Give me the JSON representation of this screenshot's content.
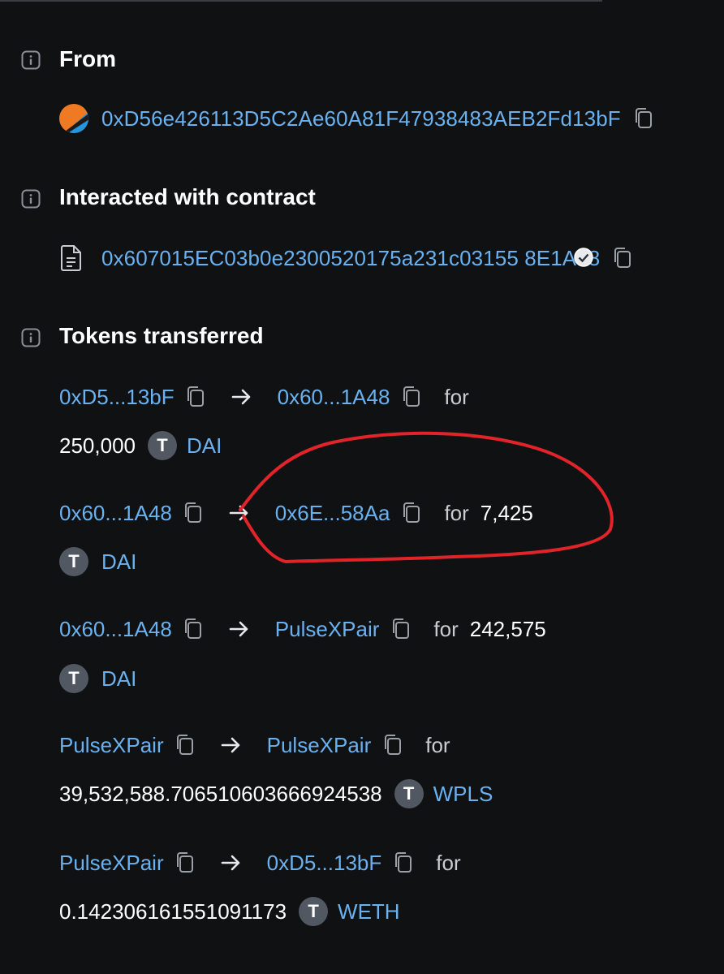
{
  "from": {
    "title": "From",
    "address": "0xD56e426113D5C2Ae60A81F47938483AEB2Fd13bF"
  },
  "contract": {
    "title": "Interacted with contract",
    "address": "0x607015EC03b0e2300520175a231c03155  8E1A48"
  },
  "tokens": {
    "title": "Tokens transferred",
    "transfers": [
      {
        "from": "0xD5...13bF",
        "to": "0x60...1A48",
        "for": "for",
        "amount": "250,000",
        "badge": "T",
        "token": "DAI"
      },
      {
        "from": "0x60...1A48",
        "to": "0x6E...58Aa",
        "for": "for",
        "amount": "7,425",
        "badge": "T",
        "token": "DAI"
      },
      {
        "from": "0x60...1A48",
        "to": "PulseXPair",
        "for": "for",
        "amount": "242,575",
        "badge": "T",
        "token": "DAI"
      },
      {
        "from": "PulseXPair",
        "to": "PulseXPair",
        "for": "for",
        "amount": "39,532,588.706510603666924538",
        "badge": "T",
        "token": "WPLS"
      },
      {
        "from": "PulseXPair",
        "to": "0xD5...13bF",
        "for": "for",
        "amount": "0.142306161551091173",
        "badge": "T",
        "token": "WETH"
      }
    ]
  },
  "colors": {
    "background": "#101113",
    "link": "#6ab1f0",
    "text": "#ffffff",
    "muted": "#c9ccd1",
    "badge": "#525861",
    "annotation": "#e0242a"
  },
  "icons": {
    "info": "info-icon",
    "copy": "copy-icon",
    "arrow": "arrow-right-icon",
    "document": "document-icon",
    "avatar": "blockie-avatar"
  }
}
